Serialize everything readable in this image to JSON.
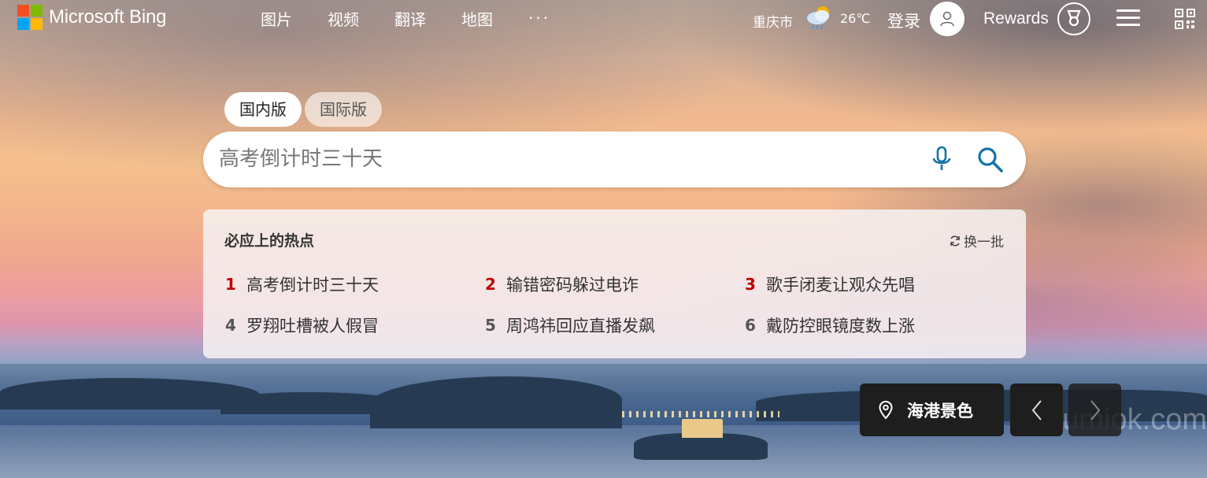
{
  "brand": {
    "logo_text": "Microsoft Bing",
    "square_colors": [
      "#f25022",
      "#7fba00",
      "#00a4ef",
      "#ffb900"
    ]
  },
  "nav": {
    "items": [
      "图片",
      "视频",
      "翻译",
      "地图"
    ],
    "more": "···"
  },
  "header_right": {
    "city": "重庆市",
    "weather_icon": "partly-cloudy-rain-icon",
    "temperature": "26℃",
    "login_label": "登录",
    "rewards_label": "Rewards"
  },
  "search": {
    "tabs": [
      {
        "label": "国内版",
        "active": true
      },
      {
        "label": "国际版",
        "active": false
      }
    ],
    "placeholder": "高考倒计时三十天",
    "value": ""
  },
  "hot": {
    "title": "必应上的热点",
    "refresh_label": "换一批",
    "items": [
      {
        "rank": "1",
        "text": "高考倒计时三十天"
      },
      {
        "rank": "2",
        "text": "输错密码躲过电诈"
      },
      {
        "rank": "3",
        "text": "歌手闭麦让观众先唱"
      },
      {
        "rank": "4",
        "text": "罗翔吐槽被人假冒"
      },
      {
        "rank": "5",
        "text": "周鸿祎回应直播发飙"
      },
      {
        "rank": "6",
        "text": "戴防控眼镜度数上涨"
      }
    ],
    "highlight_color": "#c00000"
  },
  "background": {
    "location_label": "海港景色",
    "watermark": "yumiok.com"
  },
  "colors": {
    "search_accent": "#1373a6",
    "panel_dark": "#1e1e1e"
  }
}
